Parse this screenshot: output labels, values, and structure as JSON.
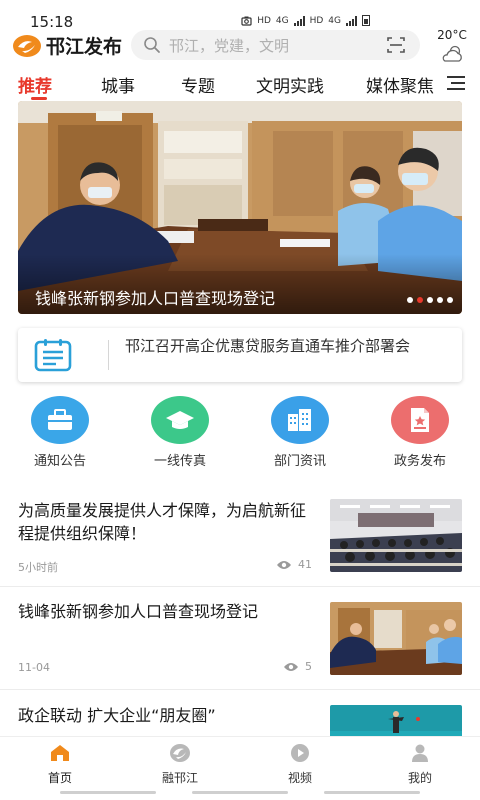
{
  "status_bar": {
    "time": "15:18",
    "hd1": "HD",
    "net1": "4G",
    "hd2": "HD",
    "net2": "4G"
  },
  "header": {
    "logo_text": "邗江发布",
    "search_placeholder": "邗江，党建，文明",
    "temperature": "20°C",
    "weather_icon": "cloud-sun-icon"
  },
  "tabs": [
    {
      "label": "推荐",
      "active": true
    },
    {
      "label": "城事",
      "active": false
    },
    {
      "label": "专题",
      "active": false
    },
    {
      "label": "文明实践",
      "active": false
    },
    {
      "label": "媒体聚焦",
      "active": false
    }
  ],
  "banner": {
    "caption": "钱峰张新钢参加人口普查现场登记",
    "slide_count": 5,
    "active_slide": 2
  },
  "notice": {
    "icon": "bulletin-icon",
    "text": "邗江召开高企优惠贷服务直通车推介部署会"
  },
  "quick_entries": [
    {
      "label": "通知公告",
      "icon": "briefcase-icon",
      "color": "#3aa6e8"
    },
    {
      "label": "一线传真",
      "icon": "graduation-cap-icon",
      "color": "#3cc88a"
    },
    {
      "label": "部门资讯",
      "icon": "buildings-icon",
      "color": "#3aa0e8"
    },
    {
      "label": "政务发布",
      "icon": "document-star-icon",
      "color": "#ec6e6e"
    }
  ],
  "news": [
    {
      "title": "为高质量发展提供人才保障，为启航新征程提供组织保障！",
      "time": "5小时前",
      "views": "41"
    },
    {
      "title": "钱峰张新钢参加人口普查现场登记",
      "time": "11-04",
      "views": "5"
    },
    {
      "title": "政企联动 扩大企业“朋友圈”",
      "time": "",
      "views": ""
    }
  ],
  "bottom_nav": [
    {
      "label": "首页",
      "icon": "home-icon",
      "active": true
    },
    {
      "label": "融邗江",
      "icon": "ronghanjiang-icon",
      "active": false
    },
    {
      "label": "视频",
      "icon": "play-icon",
      "active": false
    },
    {
      "label": "我的",
      "icon": "user-icon",
      "active": false
    }
  ],
  "colors": {
    "accent": "#e8392c",
    "logo_orange": "#f08a1c"
  }
}
